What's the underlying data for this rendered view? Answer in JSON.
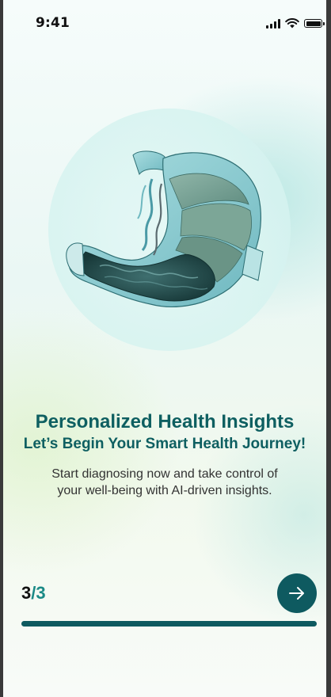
{
  "status_bar": {
    "time": "9:41",
    "icons": [
      "cellular-signal-icon",
      "wifi-icon",
      "battery-icon"
    ]
  },
  "hero": {
    "illustration": "stomach-anatomy-illustration"
  },
  "content": {
    "title": "Personalized Health Insights",
    "subtitle": "Let’s Begin Your Smart Health Journey!",
    "description_line1": "Start diagnosing now and take control of",
    "description_line2": "your well-being with AI-driven insights."
  },
  "pagination": {
    "current": "3",
    "separator": "/",
    "total": "3",
    "progress": 1.0
  },
  "next_button": {
    "icon": "arrow-right-icon"
  },
  "colors": {
    "primary": "#0e5a60",
    "accent": "#1a8a86",
    "title": "#0e5f61"
  }
}
